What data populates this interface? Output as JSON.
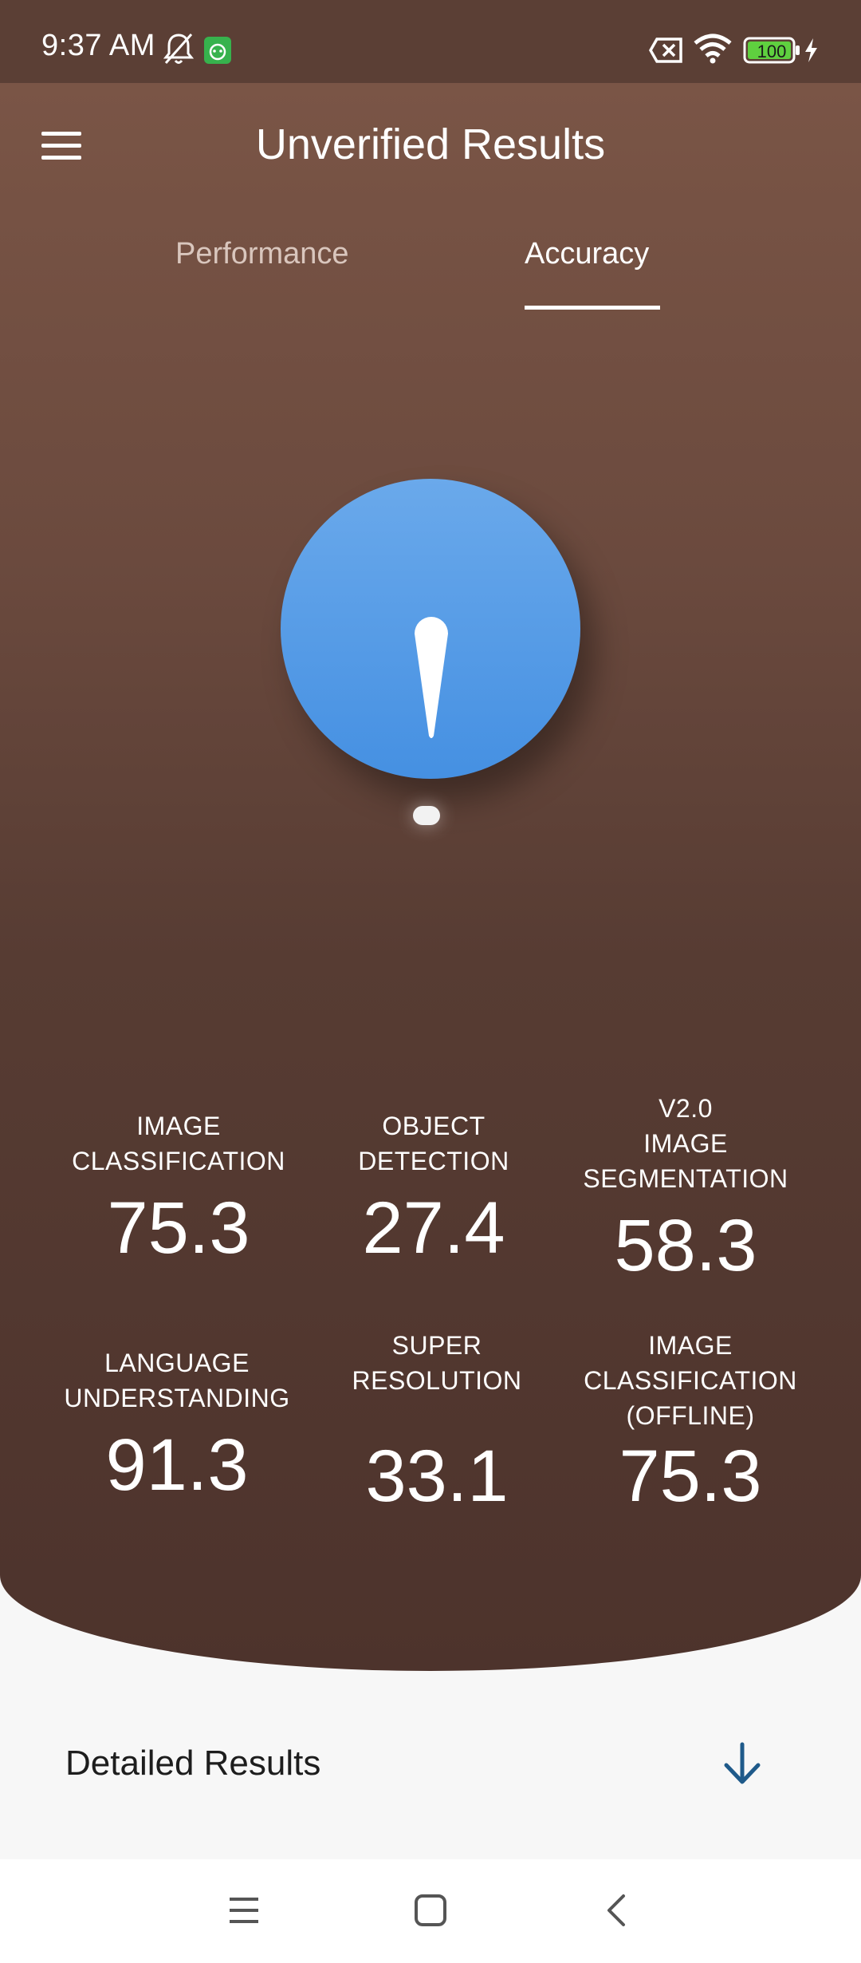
{
  "status_bar": {
    "time": "9:37 AM",
    "battery": "100",
    "icons": [
      "bell-off-icon",
      "android-app-icon",
      "sim-off-icon",
      "wifi-icon",
      "battery-icon",
      "charging-icon"
    ]
  },
  "header": {
    "title": "Unverified Results",
    "menu_icon": "hamburger-menu-icon"
  },
  "tabs": [
    {
      "label": "Performance",
      "selected": false
    },
    {
      "label": "Accuracy",
      "selected": true
    }
  ],
  "gauge": {
    "color": "#4a95e4"
  },
  "metrics": [
    {
      "label": "IMAGE\nCLASSIFICATION",
      "value": "75.3"
    },
    {
      "label": "OBJECT\nDETECTION",
      "value": "27.4"
    },
    {
      "label": "V2.0\nIMAGE\nSEGMENTATION",
      "value": "58.3"
    },
    {
      "label": "LANGUAGE\nUNDERSTANDING",
      "value": "91.3"
    },
    {
      "label": "SUPER\nRESOLUTION",
      "value": "33.1"
    },
    {
      "label": "IMAGE\nCLASSIFICATION\n(OFFLINE)",
      "value": "75.3"
    }
  ],
  "detailed_results": {
    "label": "Detailed Results",
    "icon": "arrow-down-icon",
    "accent": "#1f5a8a"
  },
  "nav_bar": {
    "buttons": [
      "recents-icon",
      "home-icon",
      "back-icon"
    ]
  }
}
